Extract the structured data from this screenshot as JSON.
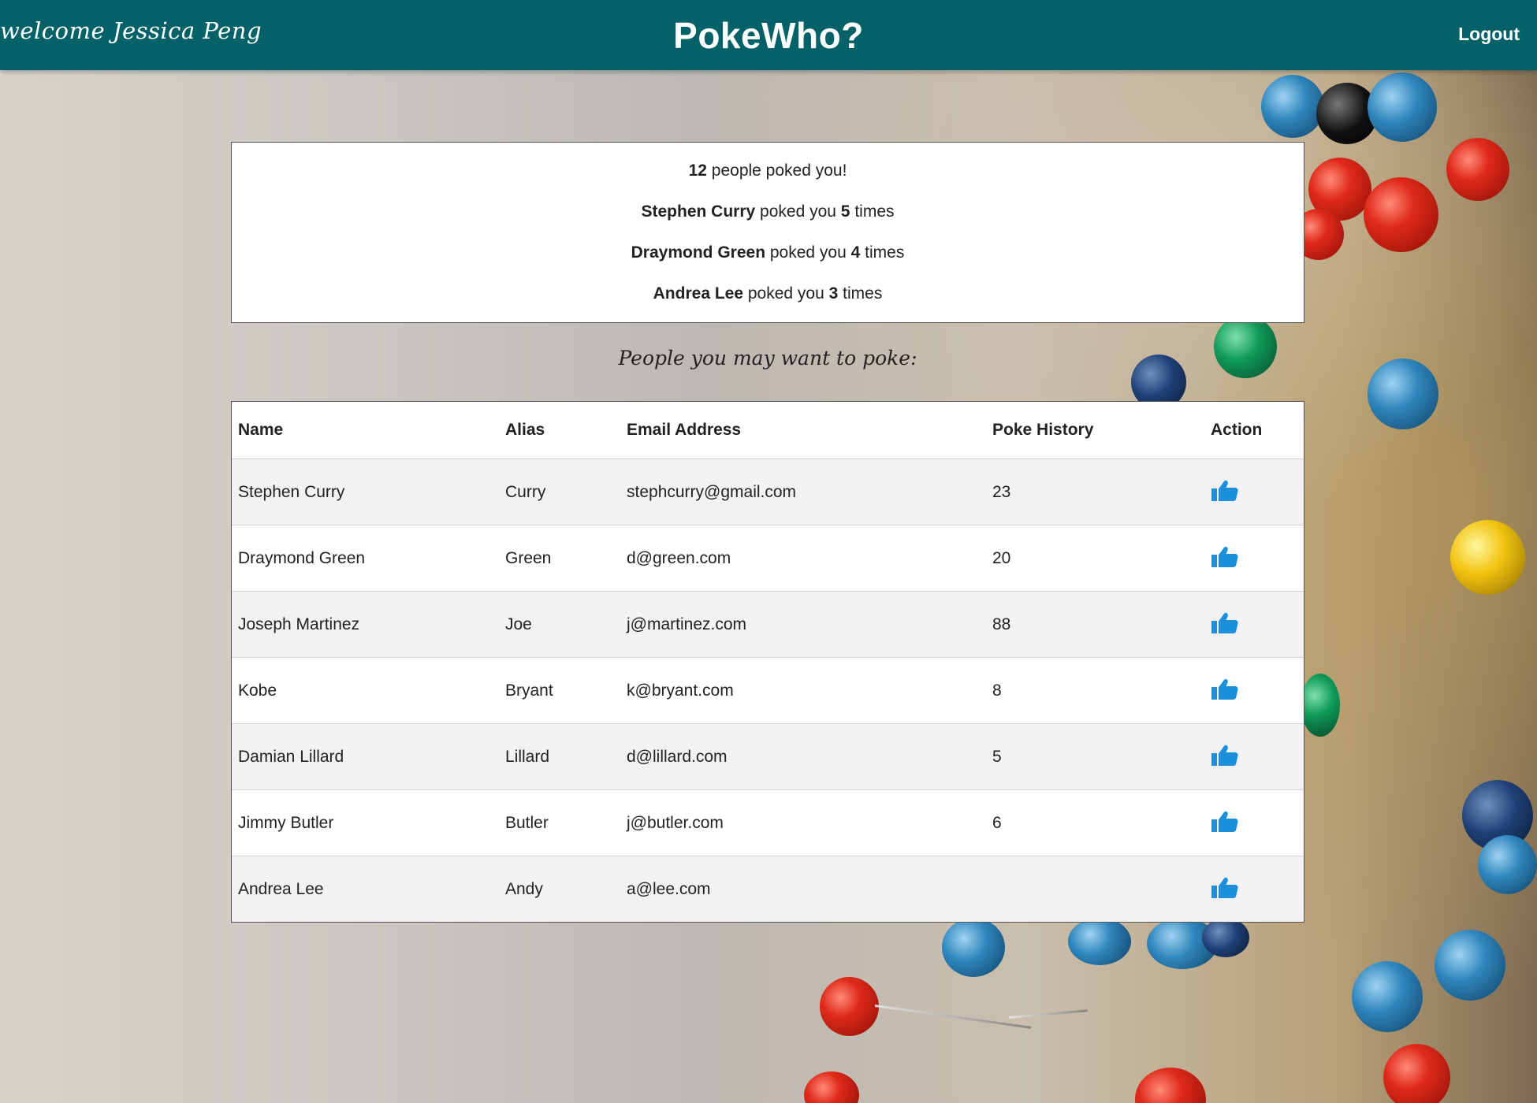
{
  "header": {
    "welcome": "welcome Jessica Peng",
    "title": "PokeWho?",
    "logout_label": "Logout"
  },
  "summary": {
    "total_count": "12",
    "total_text": "people poked you!",
    "pokers": [
      {
        "name": "Stephen Curry",
        "text_before": "poked you",
        "count": "5",
        "text_after": "times"
      },
      {
        "name": "Draymond Green",
        "text_before": "poked you",
        "count": "4",
        "text_after": "times"
      },
      {
        "name": "Andrea Lee",
        "text_before": "poked you",
        "count": "3",
        "text_after": "times"
      }
    ]
  },
  "suggestions": {
    "title": "People you may want to poke:",
    "columns": [
      "Name",
      "Alias",
      "Email Address",
      "Poke History",
      "Action"
    ],
    "rows": [
      {
        "name": "Stephen Curry",
        "alias": "Curry",
        "email": "stephcurry@gmail.com",
        "history": "23"
      },
      {
        "name": "Draymond Green",
        "alias": "Green",
        "email": "d@green.com",
        "history": "20"
      },
      {
        "name": "Joseph Martinez",
        "alias": "Joe",
        "email": "j@martinez.com",
        "history": "88"
      },
      {
        "name": "Kobe",
        "alias": "Bryant",
        "email": "k@bryant.com",
        "history": "8"
      },
      {
        "name": "Damian Lillard",
        "alias": "Lillard",
        "email": "d@lillard.com",
        "history": "5"
      },
      {
        "name": "Jimmy Butler",
        "alias": "Butler",
        "email": "j@butler.com",
        "history": "6"
      },
      {
        "name": "Andrea Lee",
        "alias": "Andy",
        "email": "a@lee.com",
        "history": ""
      }
    ],
    "action_icon": "thumbs-up-icon"
  },
  "colors": {
    "header_bg": "#036167",
    "action_icon": "#1b8fdc"
  }
}
